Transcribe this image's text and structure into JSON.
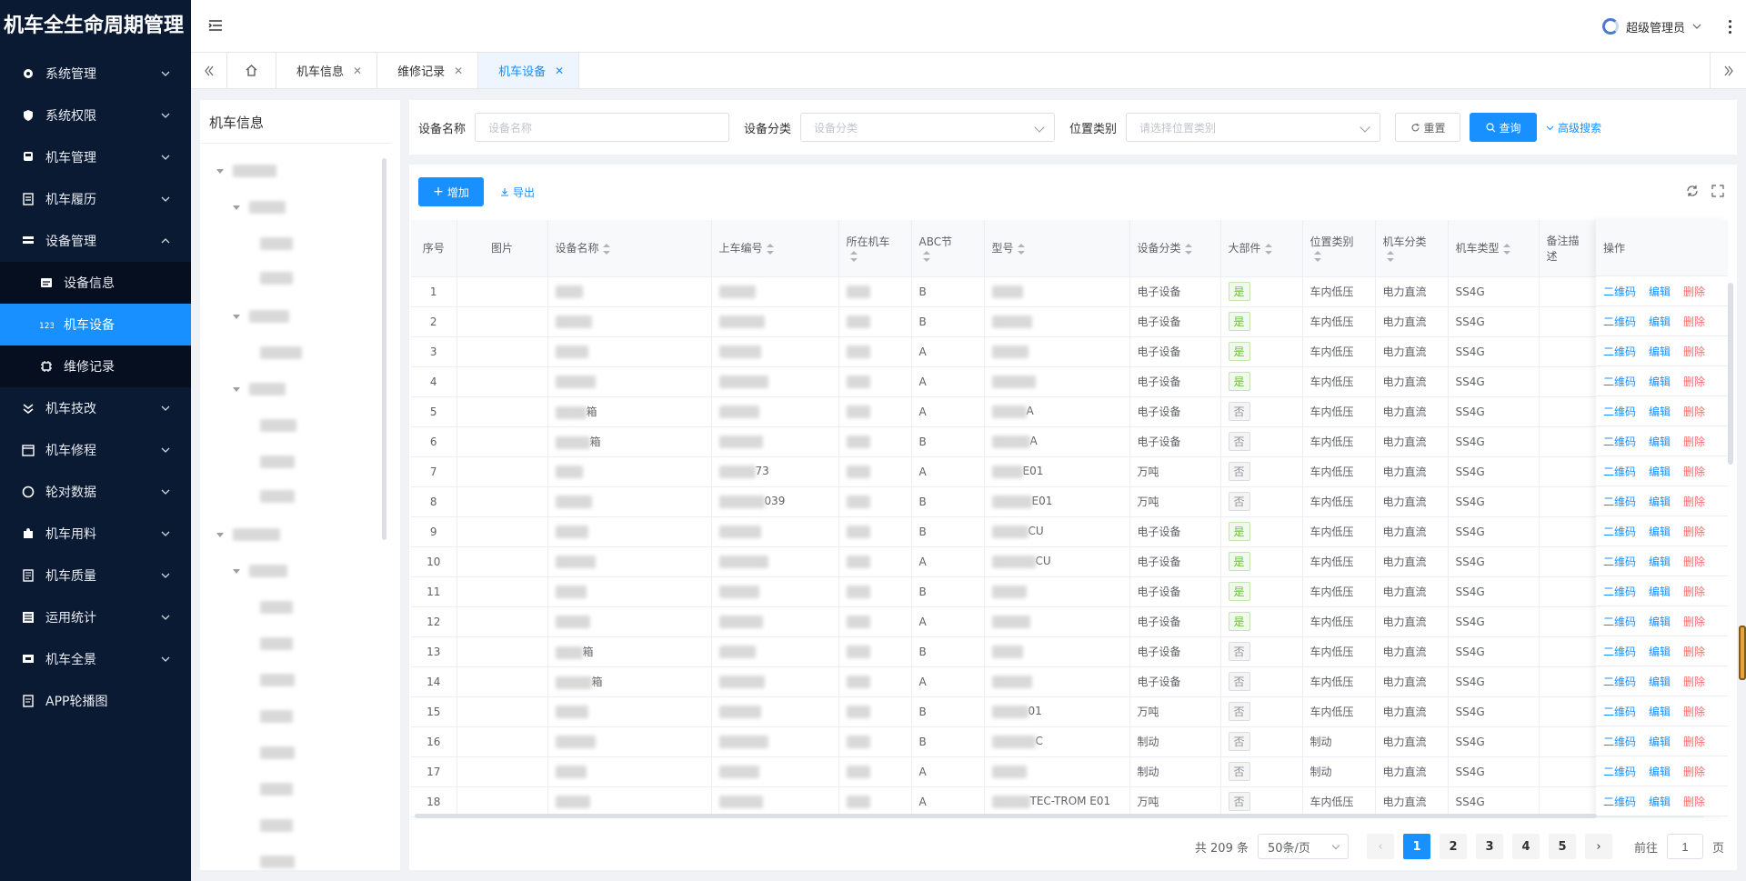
{
  "app": {
    "title": "机车全生命周期管理"
  },
  "sidebar": {
    "items": [
      {
        "label": "系统管理",
        "icon": "gear-icon"
      },
      {
        "label": "系统权限",
        "icon": "shield-icon"
      },
      {
        "label": "机车管理",
        "icon": "train-icon"
      },
      {
        "label": "机车履历",
        "icon": "list-icon"
      },
      {
        "label": "设备管理",
        "icon": "equipment-icon"
      },
      {
        "label": "机车技改",
        "icon": "double-chevron-icon"
      },
      {
        "label": "机车修程",
        "icon": "calendar-icon"
      },
      {
        "label": "轮对数据",
        "icon": "circle-icon"
      },
      {
        "label": "机车用料",
        "icon": "puzzle-icon"
      },
      {
        "label": "机车质量",
        "icon": "document-icon"
      },
      {
        "label": "运用统计",
        "icon": "stats-icon"
      },
      {
        "label": "机车全景",
        "icon": "panorama-icon"
      },
      {
        "label": "APP轮播图",
        "icon": "image-icon"
      }
    ],
    "sub_items": [
      {
        "label": "设备信息",
        "icon": "info-card-icon"
      },
      {
        "label": "机车设备",
        "icon": "number-icon"
      },
      {
        "label": "维修记录",
        "icon": "chip-icon"
      }
    ]
  },
  "header": {
    "user": "超级管理员"
  },
  "tabs": [
    {
      "label": "机车信息"
    },
    {
      "label": "维修记录"
    },
    {
      "label": "机车设备"
    }
  ],
  "tree": {
    "title": "机车信息"
  },
  "search": {
    "name_label": "设备名称",
    "name_placeholder": "设备名称",
    "category_label": "设备分类",
    "category_placeholder": "设备分类",
    "location_label": "位置类别",
    "location_placeholder": "请选择位置类别",
    "reset": "重置",
    "query": "查询",
    "advanced": "高级搜索"
  },
  "toolbar": {
    "add": "增加",
    "export": "导出"
  },
  "table": {
    "headers": [
      "序号",
      "图片",
      "设备名称",
      "上车编号",
      "所在机车",
      "ABC节",
      "型号",
      "设备分类",
      "大部件",
      "位置类别",
      "机车分类",
      "机车类型",
      "备注描述",
      "操作"
    ],
    "ops": {
      "qr": "二维码",
      "edit": "编辑",
      "delete": "删除"
    },
    "rows": [
      {
        "no": "1",
        "abc": "B",
        "category": "电子设备",
        "major": "是",
        "location": "车内低压",
        "loco_class": "电力直流",
        "loco_type": "SS4G",
        "name_suffix": "",
        "code_suffix": "",
        "model_suffix": ""
      },
      {
        "no": "2",
        "abc": "B",
        "category": "电子设备",
        "major": "是",
        "location": "车内低压",
        "loco_class": "电力直流",
        "loco_type": "SS4G",
        "name_suffix": "",
        "code_suffix": "",
        "model_suffix": ""
      },
      {
        "no": "3",
        "abc": "A",
        "category": "电子设备",
        "major": "是",
        "location": "车内低压",
        "loco_class": "电力直流",
        "loco_type": "SS4G",
        "name_suffix": "",
        "code_suffix": "",
        "model_suffix": ""
      },
      {
        "no": "4",
        "abc": "A",
        "category": "电子设备",
        "major": "是",
        "location": "车内低压",
        "loco_class": "电力直流",
        "loco_type": "SS4G",
        "name_suffix": "",
        "code_suffix": "",
        "model_suffix": ""
      },
      {
        "no": "5",
        "abc": "A",
        "category": "电子设备",
        "major": "否",
        "location": "车内低压",
        "loco_class": "电力直流",
        "loco_type": "SS4G",
        "name_suffix": "箱",
        "code_suffix": "",
        "model_suffix": "A"
      },
      {
        "no": "6",
        "abc": "B",
        "category": "电子设备",
        "major": "否",
        "location": "车内低压",
        "loco_class": "电力直流",
        "loco_type": "SS4G",
        "name_suffix": "箱",
        "code_suffix": "",
        "model_suffix": "A"
      },
      {
        "no": "7",
        "abc": "A",
        "category": "万吨",
        "major": "否",
        "location": "车内低压",
        "loco_class": "电力直流",
        "loco_type": "SS4G",
        "name_suffix": "",
        "code_suffix": "73",
        "model_suffix": "E01"
      },
      {
        "no": "8",
        "abc": "B",
        "category": "万吨",
        "major": "否",
        "location": "车内低压",
        "loco_class": "电力直流",
        "loco_type": "SS4G",
        "name_suffix": "",
        "code_suffix": "039",
        "model_suffix": "E01"
      },
      {
        "no": "9",
        "abc": "B",
        "category": "电子设备",
        "major": "是",
        "location": "车内低压",
        "loco_class": "电力直流",
        "loco_type": "SS4G",
        "name_suffix": "",
        "code_suffix": "",
        "model_suffix": "CU"
      },
      {
        "no": "10",
        "abc": "A",
        "category": "电子设备",
        "major": "是",
        "location": "车内低压",
        "loco_class": "电力直流",
        "loco_type": "SS4G",
        "name_suffix": "",
        "code_suffix": "",
        "model_suffix": "CU"
      },
      {
        "no": "11",
        "abc": "B",
        "category": "电子设备",
        "major": "是",
        "location": "车内低压",
        "loco_class": "电力直流",
        "loco_type": "SS4G",
        "name_suffix": "",
        "code_suffix": "",
        "model_suffix": ""
      },
      {
        "no": "12",
        "abc": "A",
        "category": "电子设备",
        "major": "是",
        "location": "车内低压",
        "loco_class": "电力直流",
        "loco_type": "SS4G",
        "name_suffix": "",
        "code_suffix": "",
        "model_suffix": ""
      },
      {
        "no": "13",
        "abc": "B",
        "category": "电子设备",
        "major": "否",
        "location": "车内低压",
        "loco_class": "电力直流",
        "loco_type": "SS4G",
        "name_suffix": "箱",
        "code_suffix": "",
        "model_suffix": ""
      },
      {
        "no": "14",
        "abc": "A",
        "category": "电子设备",
        "major": "否",
        "location": "车内低压",
        "loco_class": "电力直流",
        "loco_type": "SS4G",
        "name_suffix": "箱",
        "code_suffix": "",
        "model_suffix": ""
      },
      {
        "no": "15",
        "abc": "B",
        "category": "万吨",
        "major": "否",
        "location": "车内低压",
        "loco_class": "电力直流",
        "loco_type": "SS4G",
        "name_suffix": "",
        "code_suffix": "",
        "model_suffix": "01"
      },
      {
        "no": "16",
        "abc": "B",
        "category": "制动",
        "major": "否",
        "location": "制动",
        "loco_class": "电力直流",
        "loco_type": "SS4G",
        "name_suffix": "",
        "code_suffix": "",
        "model_suffix": "C"
      },
      {
        "no": "17",
        "abc": "A",
        "category": "制动",
        "major": "否",
        "location": "制动",
        "loco_class": "电力直流",
        "loco_type": "SS4G",
        "name_suffix": "",
        "code_suffix": "",
        "model_suffix": ""
      },
      {
        "no": "18",
        "abc": "A",
        "category": "万吨",
        "major": "否",
        "location": "车内低压",
        "loco_class": "电力直流",
        "loco_type": "SS4G",
        "name_suffix": "",
        "code_suffix": "",
        "model_suffix": "TEC-TROM  E01"
      }
    ]
  },
  "pagination": {
    "total": "共 209 条",
    "page_size": "50条/页",
    "pages": [
      "1",
      "2",
      "3",
      "4",
      "5"
    ],
    "goto_label": "前往",
    "goto_value": "1",
    "goto_suffix": "页"
  }
}
